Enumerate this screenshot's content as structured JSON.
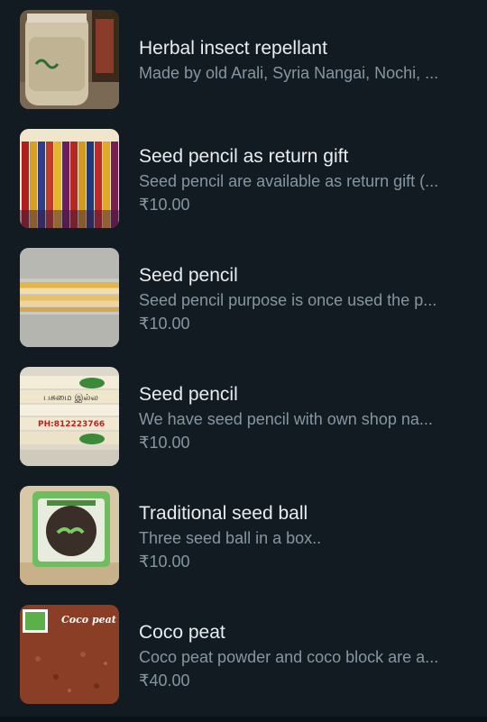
{
  "products": [
    {
      "title": "Herbal insect repellant",
      "description": "Made by old Arali, Syria Nangai, Nochi, ...",
      "price": "",
      "thumb_icon": "bottle-image"
    },
    {
      "title": "Seed pencil as return gift",
      "description": "Seed pencil are available as return gift (...",
      "price": "₹10.00",
      "thumb_icon": "colored-pencils-image"
    },
    {
      "title": "Seed pencil",
      "description": "Seed pencil purpose is once used the p...",
      "price": "₹10.00",
      "thumb_icon": "pencils-in-wrap-image"
    },
    {
      "title": "Seed pencil",
      "description": "We have seed pencil with own shop na...",
      "price": "₹10.00",
      "thumb_icon": "printed-pencils-image",
      "image_text": [
        "பசுமை இல்ல",
        "PH:812223766"
      ]
    },
    {
      "title": "Traditional seed ball",
      "description": "Three  seed ball in a box..",
      "price": "₹10.00",
      "thumb_icon": "seed-ball-box-image"
    },
    {
      "title": "Coco peat",
      "description": "Coco peat powder and coco block are a...",
      "price": "₹40.00",
      "thumb_icon": "coco-peat-image",
      "image_text": [
        "Coco peat"
      ]
    }
  ]
}
